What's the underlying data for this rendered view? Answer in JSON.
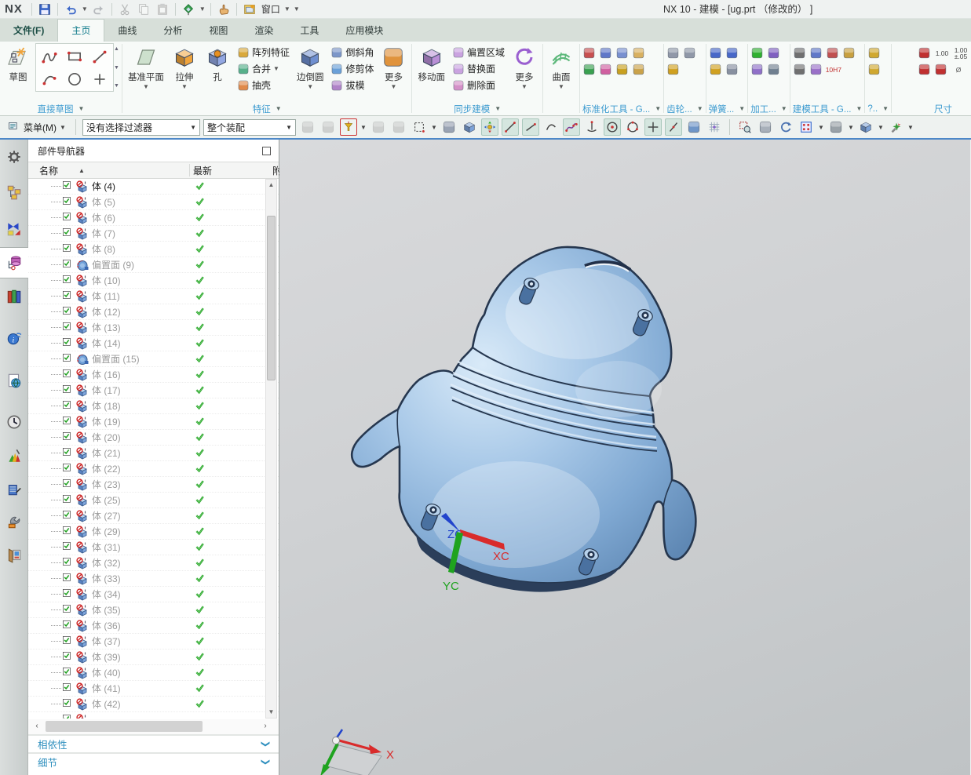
{
  "window": {
    "title": "NX 10 - 建模 - [ug.prt  （修改的） ]",
    "logo": "NX",
    "window_menu_label": "窗口"
  },
  "tabs": [
    {
      "name": "tab-file",
      "label": "文件(F)",
      "style": "file"
    },
    {
      "name": "tab-home",
      "label": "主页",
      "active": true
    },
    {
      "name": "tab-curve",
      "label": "曲线"
    },
    {
      "name": "tab-analysis",
      "label": "分析"
    },
    {
      "name": "tab-view",
      "label": "视图"
    },
    {
      "name": "tab-render",
      "label": "渲染"
    },
    {
      "name": "tab-tools",
      "label": "工具"
    },
    {
      "name": "tab-application",
      "label": "应用模块"
    }
  ],
  "ribbon": {
    "groups": [
      {
        "name": "group-direct-sketch",
        "label": "直接草图",
        "dd": true,
        "items": [
          {
            "kind": "big",
            "name": "sketch-button",
            "label": "草图",
            "icon": {
              "shape": "sketch"
            }
          },
          {
            "kind": "gallery",
            "name": "sketch-gallery",
            "glyphs": [
              "profile-icon",
              "rect-icon",
              "line-icon",
              "arc-icon",
              "circle-icon",
              "point-icon"
            ]
          }
        ]
      },
      {
        "name": "group-feature",
        "label": "特征",
        "dd": true,
        "items": [
          {
            "kind": "big",
            "name": "datum-plane-button",
            "label": "基准平面",
            "dd": true,
            "icon": {
              "shape": "plane",
              "c": "#cde0cd"
            }
          },
          {
            "kind": "big",
            "name": "extrude-button",
            "label": "拉伸",
            "dd": true,
            "icon": {
              "shape": "cube",
              "c": "#f0a43c"
            }
          },
          {
            "kind": "big",
            "name": "hole-button",
            "label": "孔",
            "icon": {
              "shape": "cubehole",
              "c": "#93a7e2"
            }
          },
          {
            "kind": "col",
            "items": [
              {
                "name": "pattern-feature-button",
                "label": "阵列特征",
                "icon": {
                  "shape": "chip",
                  "c": "#d9a93c"
                }
              },
              {
                "name": "unite-button",
                "label": "合并",
                "dd": true,
                "icon": {
                  "shape": "chip",
                  "c": "#57b08a"
                }
              },
              {
                "name": "shell-button",
                "label": "抽壳",
                "icon": {
                  "shape": "chip",
                  "c": "#e08a4a"
                }
              }
            ]
          },
          {
            "kind": "big",
            "name": "edge-blend-button",
            "label": "边倒圆",
            "dd": true,
            "icon": {
              "shape": "cube",
              "c": "#6f8fd0"
            }
          },
          {
            "kind": "col",
            "items": [
              {
                "name": "chamfer-button",
                "label": "倒斜角",
                "icon": {
                  "shape": "chip",
                  "c": "#7c96c8"
                }
              },
              {
                "name": "trim-body-button",
                "label": "修剪体",
                "icon": {
                  "shape": "chip",
                  "c": "#6aa0d8"
                }
              },
              {
                "name": "draft-button",
                "label": "拔模",
                "icon": {
                  "shape": "chip",
                  "c": "#b083c8"
                }
              }
            ]
          },
          {
            "kind": "big",
            "name": "feature-more-button",
            "label": "更多",
            "dd": true,
            "icon": {
              "shape": "chip",
              "c": "#e0933c"
            }
          }
        ]
      },
      {
        "name": "group-synchronous-modeling",
        "label": "同步建模",
        "dd": true,
        "items": [
          {
            "kind": "big",
            "name": "move-face-button",
            "label": "移动面",
            "icon": {
              "shape": "cube",
              "c": "#b98fd6"
            }
          },
          {
            "kind": "col",
            "items": [
              {
                "name": "offset-region-button",
                "label": "偏置区域",
                "icon": {
                  "shape": "chip",
                  "c": "#caa3e0"
                }
              },
              {
                "name": "replace-face-button",
                "label": "替换面",
                "icon": {
                  "shape": "chip",
                  "c": "#caa3e0"
                }
              },
              {
                "name": "delete-face-button",
                "label": "删除面",
                "icon": {
                  "shape": "chip",
                  "c": "#d490c8"
                }
              }
            ]
          },
          {
            "kind": "big",
            "name": "sync-more-button",
            "label": "更多",
            "dd": true,
            "icon": {
              "shape": "refresh",
              "c": "#9a5fd0"
            }
          }
        ]
      },
      {
        "name": "group-surface",
        "label": "",
        "items": [
          {
            "kind": "big",
            "name": "surface-button",
            "label": "曲面",
            "dd": true,
            "icon": {
              "shape": "mesh",
              "c": "#5cb87a"
            }
          }
        ]
      },
      {
        "name": "group-standardization-tools",
        "label": "标准化工具 - G...",
        "dd": true,
        "items": [
          {
            "kind": "grid",
            "name": "standardization-tool-icons",
            "rows": [
              [
                {
                  "c": "#c85050"
                },
                {
                  "c": "#6078c8"
                },
                {
                  "c": "#7890d0"
                },
                {
                  "c": "#d8b060"
                }
              ],
              [
                {
                  "c": "#3aa050"
                },
                {
                  "c": "#d060a0"
                },
                {
                  "c": "#c8a020"
                },
                {
                  "c": "#caa24a"
                }
              ]
            ]
          }
        ]
      },
      {
        "name": "group-gear-tools",
        "label": "齿轮...",
        "dd": true,
        "items": [
          {
            "kind": "grid",
            "name": "gear-tool-icons",
            "rows": [
              [
                {
                  "c": "#9098a8"
                },
                {
                  "c": "#9098a8"
                }
              ],
              [
                {
                  "c": "#d0a020"
                }
              ]
            ]
          }
        ]
      },
      {
        "name": "group-spring-tools",
        "label": "弹簧...",
        "dd": true,
        "items": [
          {
            "kind": "grid",
            "name": "spring-tool-icons",
            "rows": [
              [
                {
                  "c": "#4868c8"
                },
                {
                  "c": "#4868c8"
                }
              ],
              [
                {
                  "c": "#d0a020"
                },
                {
                  "c": "#8890a0"
                }
              ]
            ]
          }
        ]
      },
      {
        "name": "group-machining-tools",
        "label": "加工...",
        "dd": true,
        "items": [
          {
            "kind": "grid",
            "name": "machining-tool-icons",
            "rows": [
              [
                {
                  "c": "#30b030"
                },
                {
                  "c": "#8060c0"
                }
              ],
              [
                {
                  "c": "#9070c8"
                },
                {
                  "c": "#708090"
                }
              ]
            ]
          }
        ]
      },
      {
        "name": "group-modeling-tools",
        "label": "建模工具 - G...",
        "dd": true,
        "items": [
          {
            "kind": "grid",
            "name": "modeling-tool-icons",
            "rows": [
              [
                {
                  "c": "#707070"
                },
                {
                  "c": "#6078c8"
                },
                {
                  "c": "#c05050"
                },
                {
                  "c": "#c8a040"
                }
              ],
              [
                {
                  "c": "#707070"
                },
                {
                  "c": "#9a70c8"
                },
                {
                  "t": "10H7",
                  "c": "#c03030"
                }
              ]
            ]
          }
        ]
      },
      {
        "name": "group-misc-tools",
        "label": "?..",
        "dd": true,
        "items": [
          {
            "kind": "grid",
            "name": "misc-tool-icons",
            "rows": [
              [
                {
                  "c": "#d0a830"
                }
              ],
              [
                {
                  "c": "#d0a830"
                }
              ]
            ]
          }
        ]
      },
      {
        "name": "group-dimension-tools",
        "label": "尺寸",
        "right": true,
        "items": [
          {
            "kind": "grid",
            "name": "dimension-tool-icons",
            "rows": [
              [
                {
                  "c": "#c03030"
                },
                {
                  "t": "1.00",
                  "c": "#444"
                },
                {
                  "t": "1.00",
                  "t2": "±.05",
                  "c": "#444"
                }
              ],
              [
                {
                  "c": "#c03030"
                },
                {
                  "c": "#c03030"
                },
                {
                  "t": "Ø",
                  "c": "#555"
                }
              ]
            ]
          }
        ]
      }
    ]
  },
  "selection_bar": {
    "menu_label": "菜单(M)",
    "filter_value": "没有选择过滤器",
    "scope_value": "整个装配",
    "icons": [
      {
        "name": "clipboard-icon",
        "glyph": "chip",
        "c": "#8a94a0",
        "disabled": true
      },
      {
        "name": "redo-icon",
        "glyph": "chip",
        "c": "#8a94a0",
        "disabled": true
      },
      {
        "name": "snap-point-icon",
        "glyph": "snap",
        "redbox": true,
        "dropdown": true
      },
      {
        "name": "move-object-icon",
        "glyph": "chip",
        "c": "#8a94a0",
        "disabled": true
      },
      {
        "name": "sequence-icon",
        "glyph": "chip",
        "c": "#8a94a0",
        "disabled": true
      },
      {
        "name": "marquee-select-icon",
        "glyph": "marquee",
        "dropdown": true
      },
      {
        "name": "touch-select-icon",
        "glyph": "chip",
        "c": "#9aa4b4"
      },
      {
        "name": "show-box-icon",
        "glyph": "cube",
        "c": "#7ca2d8"
      },
      {
        "name": "point-constructor-icon",
        "glyph": "cross4",
        "toggled": true
      },
      {
        "name": "line-two-point-icon",
        "glyph": "line",
        "toggled": true
      },
      {
        "name": "line-angle-icon",
        "glyph": "line2",
        "toggled": true
      },
      {
        "name": "arc-icon",
        "glyph": "arc"
      },
      {
        "name": "spline-icon",
        "glyph": "spline",
        "toggled": true
      },
      {
        "name": "axis-icon",
        "glyph": "axis"
      },
      {
        "name": "circle-center-icon",
        "glyph": "circledot",
        "toggled": true
      },
      {
        "name": "circle-threept-icon",
        "glyph": "ring"
      },
      {
        "name": "plus-point-icon",
        "glyph": "plus",
        "toggled": true
      },
      {
        "name": "slash-line-icon",
        "glyph": "slash",
        "toggled": true
      },
      {
        "name": "face-select-icon",
        "glyph": "chip",
        "c": "#6f96c8"
      },
      {
        "name": "grid-snap-icon",
        "glyph": "grid"
      },
      {
        "sep": true
      },
      {
        "name": "zoom-window-icon",
        "glyph": "zoom"
      },
      {
        "name": "pan-icon",
        "glyph": "chip",
        "c": "#a8b0ba"
      },
      {
        "name": "rotate-view-icon",
        "glyph": "rotate"
      },
      {
        "name": "fit-view-icon",
        "glyph": "fit",
        "dropdown": true
      },
      {
        "name": "shaded-view-icon",
        "glyph": "chip",
        "c": "#9aa2a8",
        "dropdown": true
      },
      {
        "name": "view-cube-icon",
        "glyph": "cube",
        "c": "#7ca2d8",
        "dropdown": true
      },
      {
        "name": "visual-effects-icon",
        "glyph": "wand",
        "dropdown": true
      }
    ]
  },
  "resource_bar": {
    "items": [
      {
        "name": "roles-gear-icon"
      },
      {
        "name": "assembly-navigator-icon"
      },
      {
        "name": "constraint-navigator-icon"
      },
      {
        "name": "part-navigator-icon",
        "active": true
      },
      {
        "name": "reuse-library-icon"
      },
      {
        "name": "hd3d-tool-icon"
      },
      {
        "name": "web-browser-icon"
      },
      {
        "name": "history-icon"
      },
      {
        "name": "visual-reports-icon"
      },
      {
        "name": "system-scenes-icon"
      },
      {
        "name": "process-tools-icon"
      },
      {
        "name": "window-layout-icon"
      }
    ]
  },
  "navigator": {
    "title": "部件导航器",
    "columns": {
      "name": "名称",
      "latest": "最新",
      "clipped": "附"
    },
    "rows": [
      {
        "label": "体 (4)",
        "type": "body",
        "em": true
      },
      {
        "label": "体 (5)",
        "type": "body"
      },
      {
        "label": "体 (6)",
        "type": "body"
      },
      {
        "label": "体 (7)",
        "type": "body"
      },
      {
        "label": "体 (8)",
        "type": "body"
      },
      {
        "label": "偏置面 (9)",
        "type": "offset"
      },
      {
        "label": "体 (10)",
        "type": "body"
      },
      {
        "label": "体 (11)",
        "type": "body"
      },
      {
        "label": "体 (12)",
        "type": "body"
      },
      {
        "label": "体 (13)",
        "type": "body"
      },
      {
        "label": "体 (14)",
        "type": "body"
      },
      {
        "label": "偏置面 (15)",
        "type": "offset"
      },
      {
        "label": "体 (16)",
        "type": "body"
      },
      {
        "label": "体 (17)",
        "type": "body"
      },
      {
        "label": "体 (18)",
        "type": "body"
      },
      {
        "label": "体 (19)",
        "type": "body"
      },
      {
        "label": "体 (20)",
        "type": "body"
      },
      {
        "label": "体 (21)",
        "type": "body"
      },
      {
        "label": "体 (22)",
        "type": "body"
      },
      {
        "label": "体 (23)",
        "type": "body"
      },
      {
        "label": "体 (25)",
        "type": "body"
      },
      {
        "label": "体 (27)",
        "type": "body"
      },
      {
        "label": "体 (29)",
        "type": "body"
      },
      {
        "label": "体 (31)",
        "type": "body"
      },
      {
        "label": "体 (32)",
        "type": "body"
      },
      {
        "label": "体 (33)",
        "type": "body"
      },
      {
        "label": "体 (34)",
        "type": "body"
      },
      {
        "label": "体 (35)",
        "type": "body"
      },
      {
        "label": "体 (36)",
        "type": "body"
      },
      {
        "label": "体 (37)",
        "type": "body"
      },
      {
        "label": "体 (39)",
        "type": "body"
      },
      {
        "label": "体 (40)",
        "type": "body"
      },
      {
        "label": "体 (41)",
        "type": "body"
      },
      {
        "label": "体 (42)",
        "type": "body"
      },
      {
        "label": "",
        "type": "body"
      }
    ],
    "sections": [
      {
        "name": "section-dependencies",
        "label": "相依性"
      },
      {
        "name": "section-details",
        "label": "细节"
      }
    ]
  },
  "viewport": {
    "axes": {
      "xc": "XC",
      "yc": "YC",
      "zc": "ZC",
      "x": "X"
    }
  },
  "colors": {
    "accent": "#0e7a8a",
    "group_label": "#3d9bd0",
    "axis_x": "#d92b2b",
    "axis_y": "#1fa31f",
    "axis_z": "#2244cc",
    "check_green": "#1fa01f",
    "model_rim": "#26374f"
  }
}
